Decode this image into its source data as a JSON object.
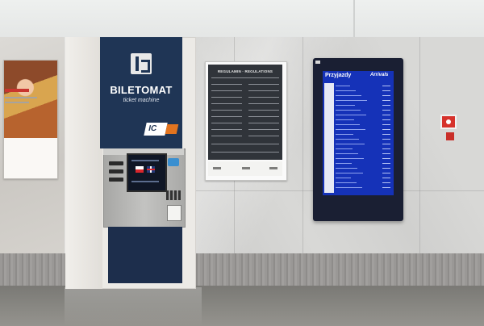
{
  "machine": {
    "title": "BILETOMAT",
    "subtitle": "ticket machine",
    "badge": "IC"
  },
  "regulations": {
    "heading": "REGULAMIN · REGULATIONS"
  },
  "board": {
    "left_heading": "Przyjazdy",
    "right_heading": "Arrivals"
  },
  "colors": {
    "machine_panel": "#1f3555",
    "board_screen": "#1532b8",
    "alarm": "#d6322c"
  }
}
